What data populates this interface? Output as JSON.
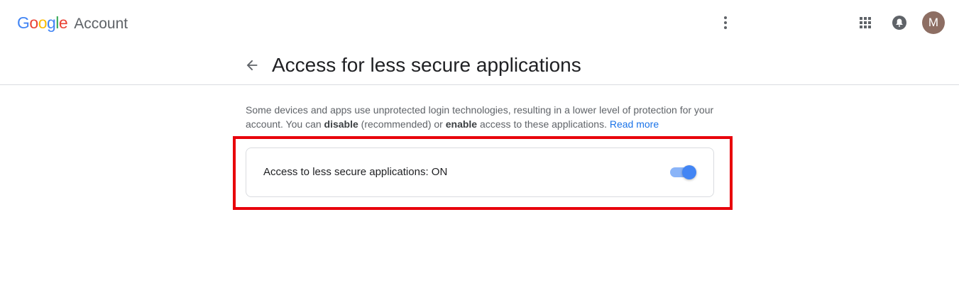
{
  "header": {
    "logo_letters": [
      {
        "char": "G",
        "color": "#4285F4"
      },
      {
        "char": "o",
        "color": "#EA4335"
      },
      {
        "char": "o",
        "color": "#FBBC05"
      },
      {
        "char": "g",
        "color": "#4285F4"
      },
      {
        "char": "l",
        "color": "#34A853"
      },
      {
        "char": "e",
        "color": "#EA4335"
      }
    ],
    "logo_suffix": "Account",
    "icons": {
      "more": "more-vert-icon",
      "apps": "apps-grid-icon",
      "notifications": "bell-icon"
    },
    "avatar_initial": "M",
    "avatar_color": "#8D6E63"
  },
  "page": {
    "title": "Access for less secure applications",
    "back_icon": "arrow-back-icon"
  },
  "description": {
    "part1": "Some devices and apps use unprotected login technologies, resulting in a lower level of protection for your account. You can ",
    "bold1": "disable",
    "part2": " (recommended) or ",
    "bold2": "enable",
    "part3": " access to these applications. ",
    "link": "Read more"
  },
  "setting": {
    "label": "Access to less secure applications: ON",
    "toggle_on": true,
    "toggle_color": "#4285F4",
    "highlight_color": "#E8000B"
  }
}
